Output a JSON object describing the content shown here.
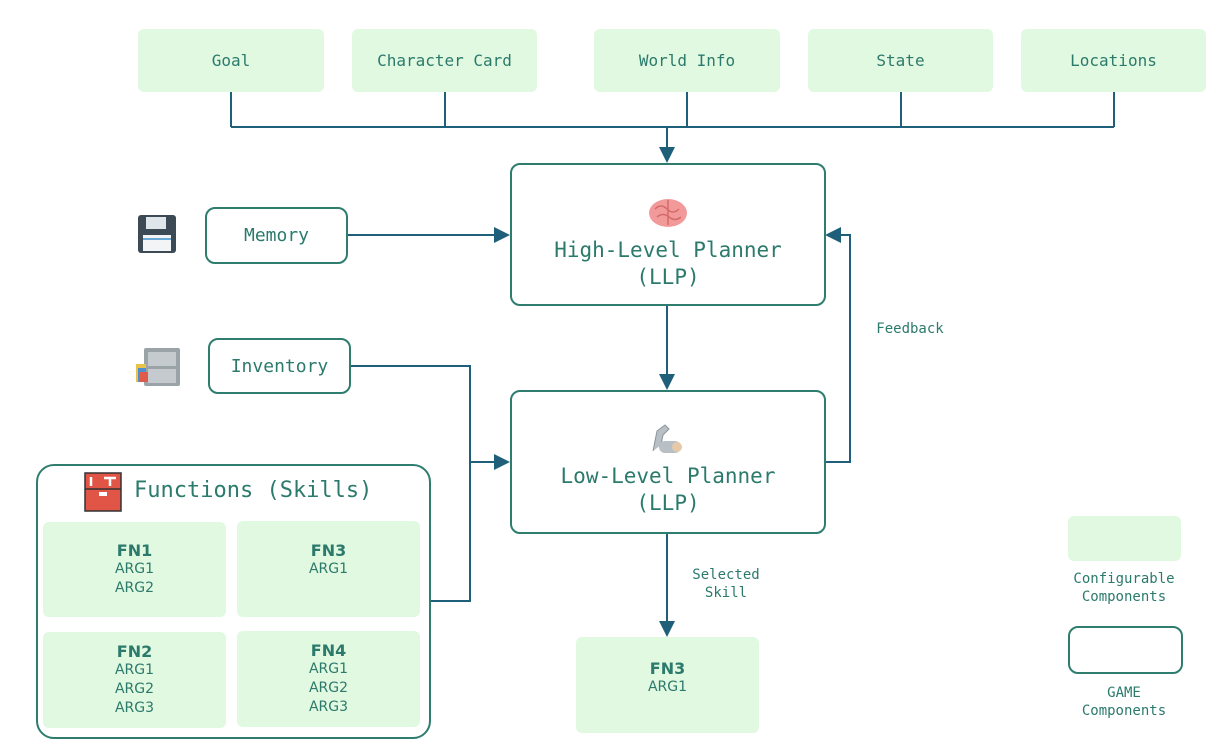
{
  "inputs": [
    "Goal",
    "Character Card",
    "World Info",
    "State",
    "Locations"
  ],
  "memory": {
    "label": "Memory",
    "icon": "floppy-disk-icon"
  },
  "inventory": {
    "label": "Inventory",
    "icon": "file-cabinet-icon"
  },
  "high_level_planner": {
    "line1": "High-Level Planner",
    "line2": "(LLP)",
    "icon": "brain-icon"
  },
  "low_level_planner": {
    "line1": "Low-Level Planner",
    "line2": "(LLP)",
    "icon": "mechanical-arm-icon"
  },
  "feedback_label": "Feedback",
  "selected_skill_label": [
    "Selected",
    "Skill"
  ],
  "functions": {
    "title": "Functions (Skills)",
    "icon": "toolbox-icon",
    "items": [
      {
        "name": "FN1",
        "args": [
          "ARG1",
          "ARG2"
        ]
      },
      {
        "name": "FN3",
        "args": [
          "ARG1"
        ]
      },
      {
        "name": "FN2",
        "args": [
          "ARG1",
          "ARG2",
          "ARG3"
        ]
      },
      {
        "name": "FN4",
        "args": [
          "ARG1",
          "ARG2",
          "ARG3"
        ]
      }
    ]
  },
  "output": {
    "name": "FN3",
    "args": [
      "ARG1"
    ]
  },
  "legend": {
    "configurable": [
      "Configurable",
      "Components"
    ],
    "game": [
      "GAME",
      "Components"
    ]
  },
  "colors": {
    "configurable_fill": "#e1f8e1",
    "game_border": "#2e7d6e",
    "text": "#2b7a6c",
    "arrow": "#1f5f7a"
  }
}
